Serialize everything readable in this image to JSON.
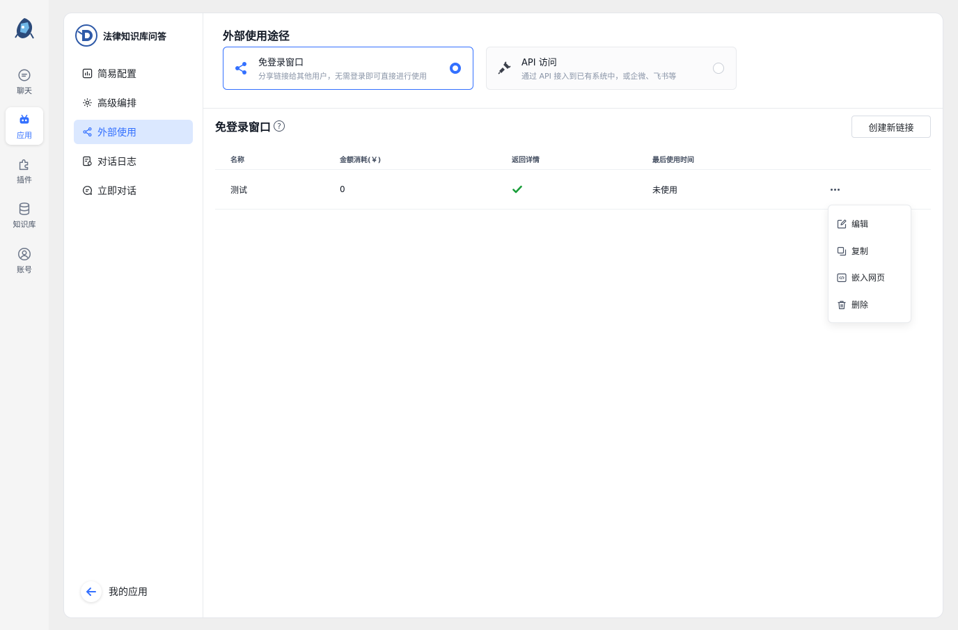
{
  "rail": {
    "items": [
      {
        "label": "聊天",
        "icon": "chat-icon"
      },
      {
        "label": "应用",
        "icon": "robot-icon",
        "active": true
      },
      {
        "label": "插件",
        "icon": "puzzle-icon"
      },
      {
        "label": "知识库",
        "icon": "database-icon"
      },
      {
        "label": "账号",
        "icon": "user-icon"
      }
    ]
  },
  "app": {
    "name": "法律知识库问答"
  },
  "subnav": {
    "items": [
      {
        "label": "简易配置",
        "icon": "chart-icon"
      },
      {
        "label": "高级编排",
        "icon": "gear-icon"
      },
      {
        "label": "外部使用",
        "icon": "share-icon",
        "active": true
      },
      {
        "label": "对话日志",
        "icon": "log-icon"
      },
      {
        "label": "立即对话",
        "icon": "chat-icon"
      }
    ],
    "back_label": "我的应用"
  },
  "external": {
    "title": "外部使用途径",
    "options": [
      {
        "title": "免登录窗口",
        "desc": "分享链接给其他用户，无需登录即可直接进行使用",
        "selected": true
      },
      {
        "title": "API 访问",
        "desc": "通过 API 接入到已有系统中，或企微、飞书等",
        "selected": false
      }
    ]
  },
  "share": {
    "title": "免登录窗口",
    "help": "?",
    "create_label": "创建新链接",
    "columns": [
      "名称",
      "金额消耗(￥)",
      "返回详情",
      "最后使用时间"
    ],
    "rows": [
      {
        "name": "测试",
        "cost": "0",
        "detail": true,
        "last_used": "未使用"
      }
    ],
    "menu": [
      "编辑",
      "复制",
      "嵌入网页",
      "删除"
    ]
  },
  "colors": {
    "accent": "#3370ff",
    "check": "#1a9e3a"
  }
}
